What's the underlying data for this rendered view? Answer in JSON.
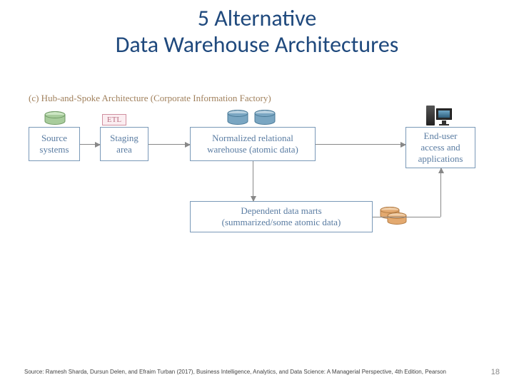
{
  "title_line1": "5 Alternative",
  "title_line2": "Data Warehouse Architectures",
  "caption": "(c) Hub-and-Spoke Architecture (Corporate Information Factory)",
  "etl_label": "ETL",
  "boxes": {
    "source_systems": "Source\nsystems",
    "staging_area": "Staging\narea",
    "warehouse": "Normalized relational\nwarehouse (atomic data)",
    "end_user": "End-user\naccess and\napplications",
    "data_marts": "Dependent data marts\n(summarized/some atomic data)"
  },
  "db_colors": {
    "green": {
      "body": "#a8cc9c",
      "top": "#cde6c4",
      "edge": "#6f9a64"
    },
    "blue": {
      "body": "#7aa6c2",
      "top": "#b8d1e0",
      "edge": "#4a7a98"
    },
    "orange": {
      "body": "#e3a96f",
      "top": "#f1d0ab",
      "edge": "#b47d45"
    }
  },
  "source_citation": "Source: Ramesh Sharda, Dursun Delen, and Efraim Turban (2017),  Business Intelligence, Analytics, and Data Science: A Managerial Perspective, 4th Edition, Pearson",
  "page_number": "18"
}
